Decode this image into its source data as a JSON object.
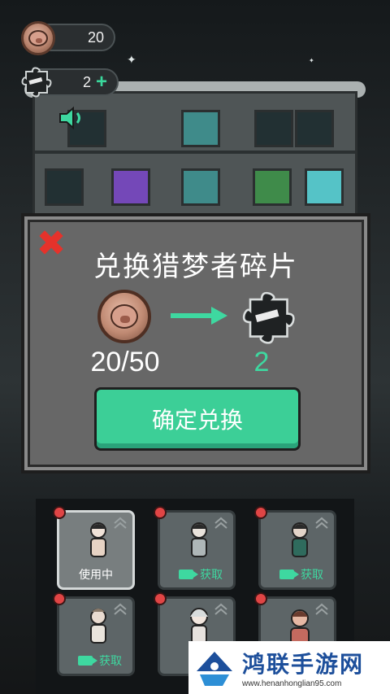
{
  "hud": {
    "coins": "20",
    "pieces": "2",
    "add_symbol": "+"
  },
  "dialog": {
    "title": "兑换猎梦者碎片",
    "cost": "20/50",
    "reward": "2",
    "confirm_label": "确定兑换",
    "close_symbol": "✖"
  },
  "characters": [
    {
      "label": "使用中",
      "state": "in-use",
      "dress": "#e7d3c4"
    },
    {
      "label": "获取",
      "state": "locked",
      "dress": "#aeb6b7"
    },
    {
      "label": "获取",
      "state": "locked",
      "dress": "#2f6b5d"
    },
    {
      "label": "获取",
      "state": "locked",
      "dress": "#e9e4dc"
    },
    {
      "label": "",
      "state": "locked",
      "dress": "#e6e1dd"
    },
    {
      "label": "",
      "state": "locked",
      "dress": "#c46a5f"
    }
  ],
  "watermark": {
    "title": "鸿联手游网",
    "url": "www.henanhonglian95.com"
  },
  "colors": {
    "accent_green": "#3ccf97",
    "close_red": "#e5322b",
    "dialog_bg": "#676767"
  },
  "icons": [
    "pig-coin-icon",
    "dream-piece-icon",
    "speaker-icon",
    "arrow-right-icon",
    "video-camera-icon",
    "chevron-up-icon",
    "close-icon"
  ]
}
